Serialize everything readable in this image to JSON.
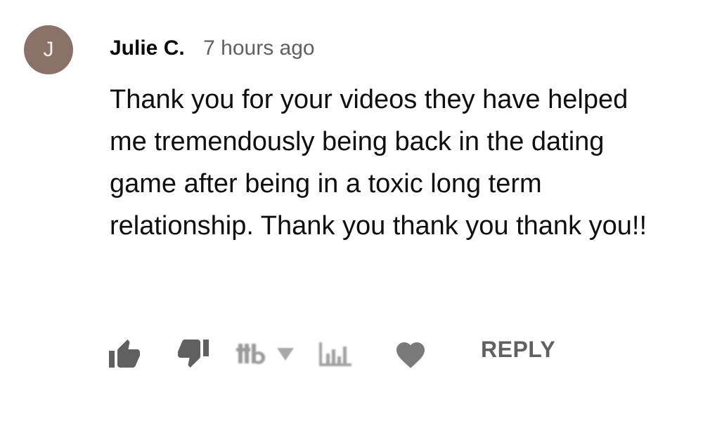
{
  "comment": {
    "avatar_letter": "J",
    "author": "Julie C.",
    "timestamp": "7 hours ago",
    "text": "Thank you for your videos they have helped me tremendously being back in the dating game after being in a toxic long term relationship. Thank you thank you thank you!!"
  },
  "actions": {
    "like_icon": "thumbs-up-icon",
    "dislike_icon": "thumbs-down-icon",
    "heart_icon": "heart-icon",
    "reply_label": "REPLY"
  },
  "colors": {
    "avatar_bg": "#8a7268",
    "icon_gray": "#606060",
    "text": "#0f0f0f",
    "meta_gray": "#606060"
  }
}
